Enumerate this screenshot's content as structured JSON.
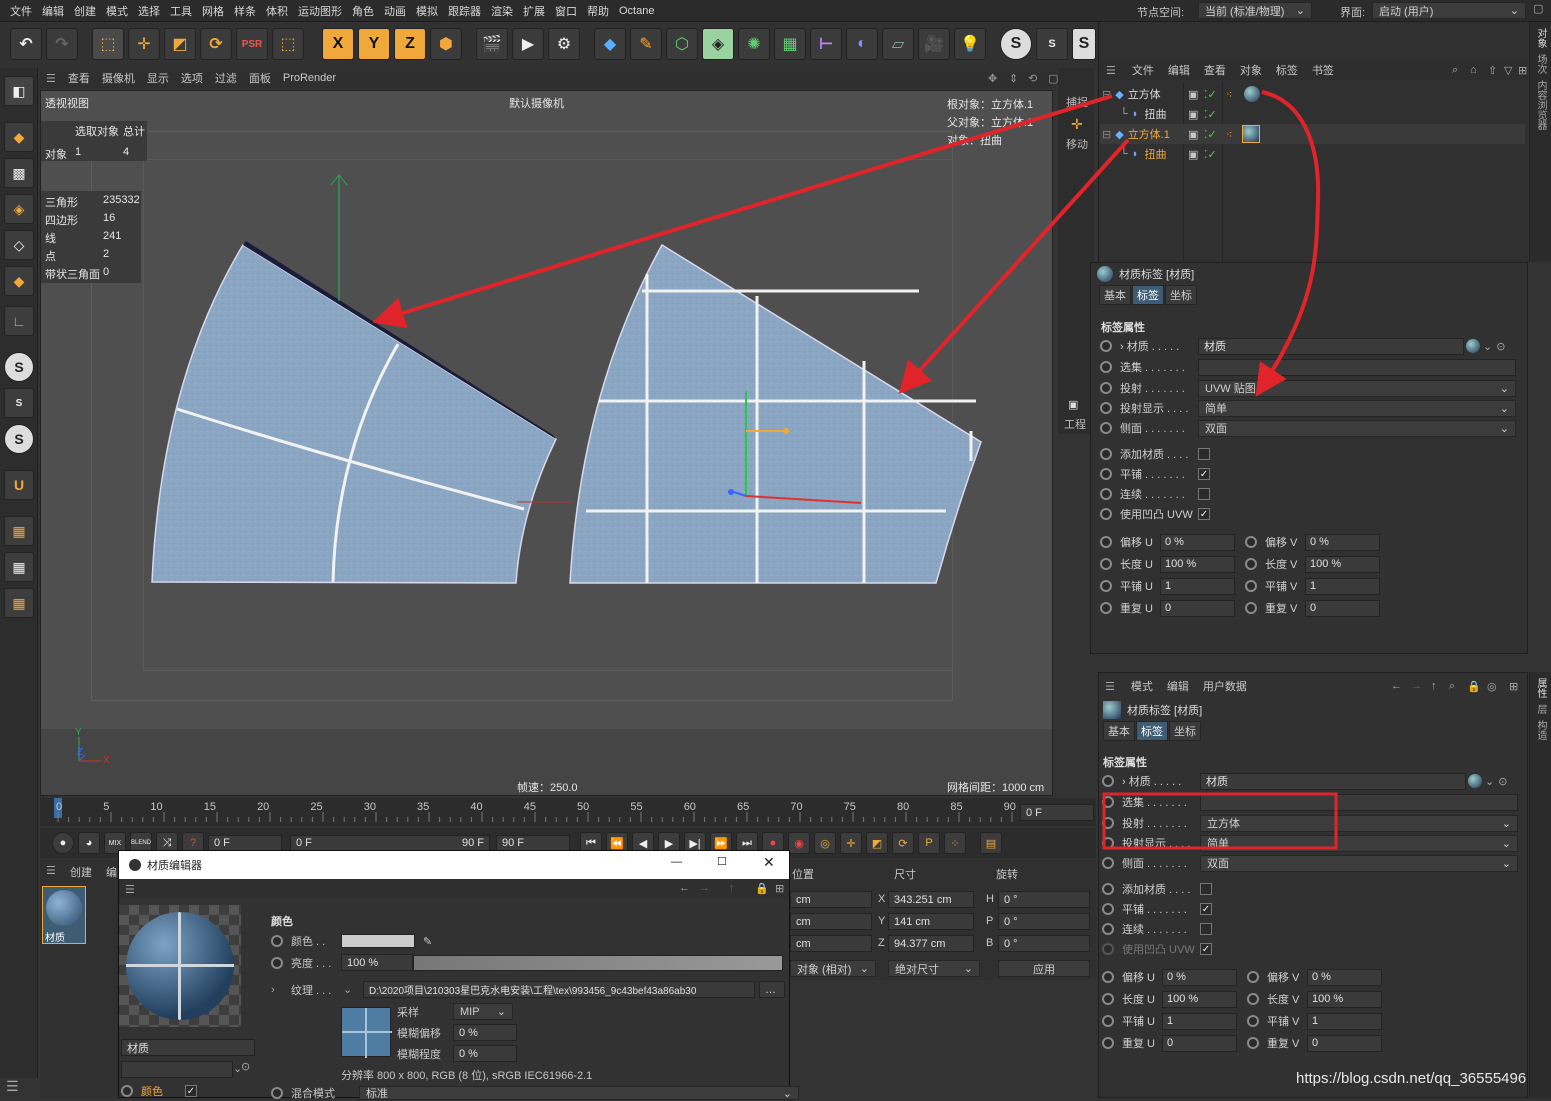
{
  "menu": [
    "文件",
    "编辑",
    "创建",
    "模式",
    "选择",
    "工具",
    "网格",
    "样条",
    "体积",
    "运动图形",
    "角色",
    "动画",
    "模拟",
    "跟踪器",
    "渲染",
    "扩展",
    "窗口",
    "帮助",
    "Octane"
  ],
  "node_space_label": "节点空间:",
  "node_space_value": "当前 (标准/物理)",
  "layout_label": "界面:",
  "layout_value": "启动 (用户)",
  "vp_menu": [
    "查看",
    "摄像机",
    "显示",
    "选项",
    "过滤",
    "面板",
    "ProRender"
  ],
  "viewport": {
    "name": "透视视图",
    "camera": "默认摄像机",
    "root": "根对象：立方体.1",
    "parent": "父对象：立方体.1",
    "object": "对象：扭曲",
    "fps": "帧速：250.0",
    "grid": "网格间距：1000 cm"
  },
  "stats": {
    "h1": "选取对象",
    "h2": "总计",
    "obj_label": "对象",
    "obj_sel": "1",
    "obj_total": "4",
    "tri_label": "三角形",
    "tri": "235332",
    "quad_label": "四边形",
    "quad": "16",
    "edge_label": "线",
    "edge": "241",
    "pt_label": "点",
    "pt": "2",
    "strip_label": "带状三角面",
    "strip": "0"
  },
  "axis": {
    "y": "Y",
    "z": "Z",
    "x": "X"
  },
  "timeline": {
    "ticks": [
      "0",
      "5",
      "10",
      "15",
      "20",
      "25",
      "30",
      "35",
      "40",
      "45",
      "50",
      "55",
      "60",
      "65",
      "70",
      "75",
      "80",
      "85",
      "90"
    ],
    "frame": "0 F"
  },
  "ctrl": {
    "f1": "0 F",
    "f2": "0 F",
    "f3": "90 F",
    "f4": "90 F",
    "mix": "MIX",
    "blend": "BLEND"
  },
  "side_move": {
    "snap": "捕捉",
    "move": "移动",
    "proj": "工程"
  },
  "obj_menu": [
    "文件",
    "编辑",
    "查看",
    "对象",
    "标签",
    "书签"
  ],
  "objects": [
    {
      "name": "立方体",
      "child": "扭曲"
    },
    {
      "name": "立方体.1",
      "child": "扭曲"
    }
  ],
  "side_tabs": [
    "对象",
    "场次",
    "内容浏览器"
  ],
  "side_tabs2": [
    "属性",
    "层",
    "构造"
  ],
  "tag_panel": {
    "title": "材质标签 [材质]",
    "tabs": [
      "基本",
      "标签",
      "坐标"
    ],
    "section": "标签属性",
    "mat_label": "材质 . . . . .",
    "mat_value": "材质",
    "sel_label": "选集 . . . . . . .",
    "proj_label": "投射 . . . . . . .",
    "proj_value": "UVW 贴图",
    "pdisp_label": "投射显示 . . . .",
    "pdisp_value": "简单",
    "side_label": "侧面 . . . . . . .",
    "side_value": "双面",
    "addmat": "添加材质 . . . .",
    "tile": "平铺 . . . . . . .",
    "seam": "连续 . . . . . . .",
    "bump": "使用凹凸 UVW",
    "offu": "偏移 U",
    "offu_v": "0 %",
    "offv": "偏移 V",
    "offv_v": "0 %",
    "lenu": "长度 U",
    "lenu_v": "100 %",
    "lenv": "长度 V",
    "lenv_v": "100 %",
    "tileu": "平铺 U",
    "tileu_v": "1",
    "tilev": "平铺 V",
    "tilev_v": "1",
    "repu": "重复 U",
    "repu_v": "0",
    "repv": "重复 V",
    "repv_v": "0"
  },
  "attr_menu": [
    "模式",
    "编辑",
    "用户数据"
  ],
  "attr_panel": {
    "proj_value": "立方体",
    "pdisp_value": "简单",
    "side_value": "双面"
  },
  "mat_mgr": {
    "menu": [
      "创建",
      "编"
    ],
    "mat": "材质"
  },
  "mat_editor": {
    "title": "材质编辑器",
    "section": "颜色",
    "color_label": "颜色 . .",
    "bright_label": "亮度 . . .",
    "bright_value": "100 %",
    "tex_label": "纹理 . . .",
    "tex_path": "D:\\2020项目\\210303星巴克水电安装\\工程\\tex\\993456_9c43bef43a86ab30",
    "sample_label": "采样",
    "sample_value": "MIP",
    "blur_off_label": "模糊偏移",
    "blur_off_value": "0 %",
    "blur_lvl_label": "模糊程度",
    "blur_lvl_value": "0 %",
    "res": "分辨率 800 x 800, RGB (8 位), sRGB IEC61966-2.1",
    "mat_name": "材质",
    "ch_color": "颜色",
    "blend_label": "混合模式",
    "blend_value": "标准"
  },
  "coord": {
    "pos": "位置",
    "size": "尺寸",
    "rot": "旋转",
    "sx": "343.251 cm",
    "sy": "141 cm",
    "sz": "94.377 cm",
    "h": "0 °",
    "p": "0 °",
    "b": "0 °",
    "mode": "对象 (相对)",
    "abs": "绝对尺寸",
    "apply": "应用",
    "cm": "cm"
  },
  "watermark": "https://blog.csdn.net/qq_36555496"
}
